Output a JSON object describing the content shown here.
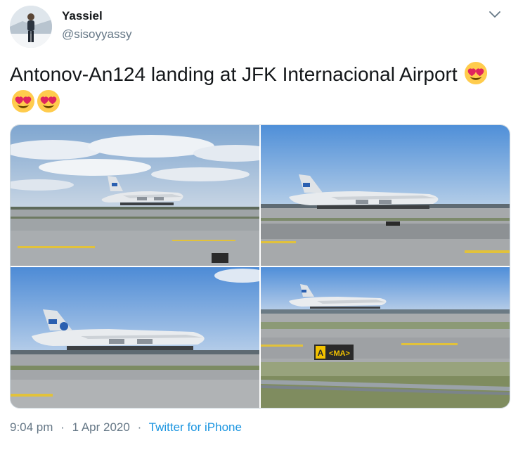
{
  "author": {
    "display_name": "Yassiel",
    "handle": "@sisoyyassy"
  },
  "tweet": {
    "text": "Antonov-An124 landing at JFK Internacional Airport",
    "emoji": [
      "heart-eyes",
      "heart-eyes",
      "heart-eyes"
    ]
  },
  "media": {
    "photos": [
      {
        "subject": "aircraft-on-runway",
        "sky": "cloudy"
      },
      {
        "subject": "aircraft-on-runway",
        "sky": "clear"
      },
      {
        "subject": "aircraft-on-runway",
        "sky": "clear"
      },
      {
        "subject": "aircraft-on-runway",
        "sky": "clear",
        "sign_text": "A MA"
      }
    ]
  },
  "footer": {
    "time": "9:04 pm",
    "date": "1 Apr 2020",
    "source": "Twitter for iPhone",
    "separator": "·"
  },
  "colors": {
    "text": "#14171a",
    "secondary": "#657786",
    "link": "#1b95e0",
    "border": "#ccd6dd",
    "sign_yellow": "#f2c200"
  }
}
